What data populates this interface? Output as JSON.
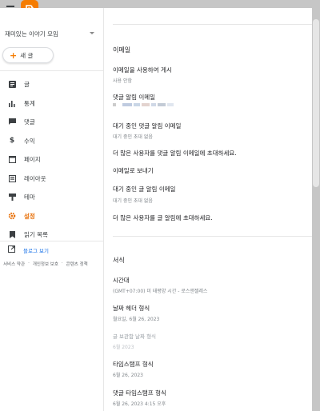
{
  "blog": {
    "name": "재미있는 이야기 모임"
  },
  "new_post": {
    "label": "새 글"
  },
  "nav": {
    "items": [
      {
        "label": "글",
        "icon": "posts-icon"
      },
      {
        "label": "통계",
        "icon": "stats-icon"
      },
      {
        "label": "댓글",
        "icon": "comments-icon"
      },
      {
        "label": "수익",
        "icon": "earnings-icon"
      },
      {
        "label": "페이지",
        "icon": "pages-icon"
      },
      {
        "label": "레이아웃",
        "icon": "layout-icon"
      },
      {
        "label": "테마",
        "icon": "theme-icon"
      },
      {
        "label": "설정",
        "icon": "settings-icon"
      },
      {
        "label": "읽기 목록",
        "icon": "reading-list-icon"
      }
    ],
    "active": "설정"
  },
  "view_blog": {
    "label": "블로그 보기"
  },
  "footer": {
    "terms": "서비스 약관",
    "privacy": "개인정보 보호",
    "content_policy": "콘텐츠 정책",
    "sep": "·"
  },
  "email": {
    "section_title": "이메일",
    "post_using_email": {
      "label": "이메일을 사용하여 게시",
      "value": "사용 안함"
    },
    "comment_notify": {
      "label": "댓글 알림 이메일"
    },
    "pending_comment": {
      "label": "대기 중인 댓글 알림 이메일",
      "value": "대기 중인 초대 없음"
    },
    "invite_comment": "더 많은 사용자를 댓글 알림 이메일에 초대하세요.",
    "email_posts_to": "이메일로 보내기",
    "pending_post": {
      "label": "대기 중인 글 알림 이메일",
      "value": "대기 중인 초대 없음"
    },
    "invite_post": "더 많은 사용자를 글 알림에 초대하세요."
  },
  "format": {
    "section_title": "서식",
    "timezone": {
      "label": "시간대",
      "value": "(GMT+07:00) 미 태평양 시간 - 로스앤젤레스"
    },
    "date_header": {
      "label": "날짜 헤더 형식",
      "value": "월요일, 6월 26, 2023"
    },
    "post_date_short": {
      "label": "글 보관함 날짜 형식",
      "value": "6월 2023"
    },
    "timestamp": {
      "label": "타임스탬프 형식",
      "value": "6월 26, 2023"
    },
    "comment_timestamp": {
      "label": "댓글 타임스탬프 형식",
      "value": "6월 26, 2023 4:15 오후"
    }
  },
  "colors": {
    "accent": "#e8710a",
    "logo": "#f57c00",
    "link": "#1a73e8"
  }
}
